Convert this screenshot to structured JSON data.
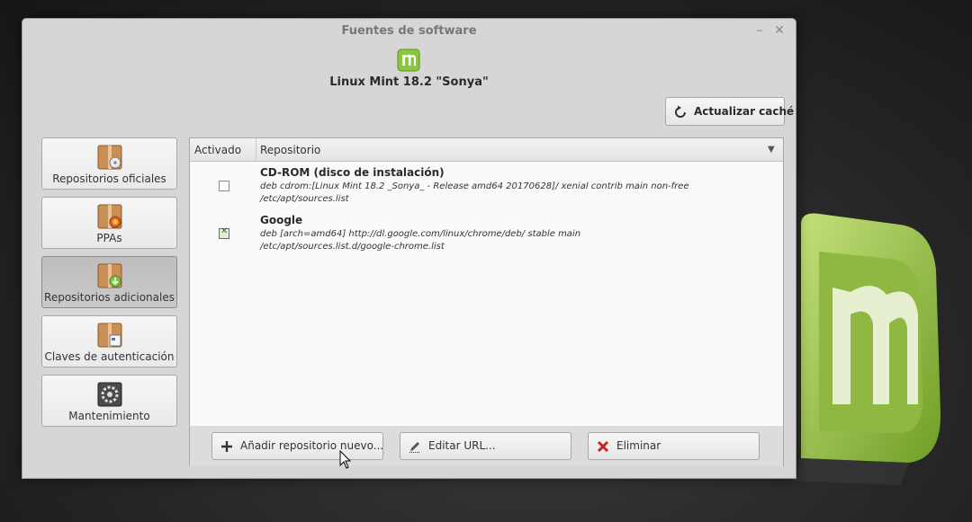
{
  "window": {
    "title": "Fuentes de software",
    "minimize_glyph": "–",
    "close_glyph": "✕"
  },
  "header": {
    "distro": "Linux Mint 18.2 \"Sonya\""
  },
  "toolbar": {
    "refresh_label": "Actualizar caché",
    "refresh_icon": "refresh-icon"
  },
  "sidebar": {
    "items": [
      {
        "label": "Repositorios oficiales",
        "icon": "package-cd-icon",
        "active": false
      },
      {
        "label": "PPAs",
        "icon": "package-ppa-icon",
        "active": false
      },
      {
        "label": "Repositorios adicionales",
        "icon": "package-add-icon",
        "active": true
      },
      {
        "label": "Claves de autenticación",
        "icon": "package-keys-icon",
        "active": false
      },
      {
        "label": "Mantenimiento",
        "icon": "maintenance-gear-icon",
        "active": false
      }
    ]
  },
  "table": {
    "columns": [
      "Activado",
      "Repositorio"
    ],
    "rows": [
      {
        "enabled": false,
        "name": "CD-ROM (disco de instalación)",
        "line": "deb cdrom:[Linux Mint 18.2 _Sonya_ - Release amd64 20170628]/ xenial contrib main non-free",
        "file": "/etc/apt/sources.list"
      },
      {
        "enabled": true,
        "name": "Google",
        "line": "deb [arch=amd64] http://dl.google.com/linux/chrome/deb/ stable main",
        "file": "/etc/apt/sources.list.d/google-chrome.list"
      }
    ]
  },
  "actions": {
    "add_label": "Añadir repositorio nuevo...",
    "edit_label": "Editar URL...",
    "delete_label": "Eliminar"
  },
  "colors": {
    "mint_green": "#8cc63f",
    "delete_red": "#cc2222"
  }
}
